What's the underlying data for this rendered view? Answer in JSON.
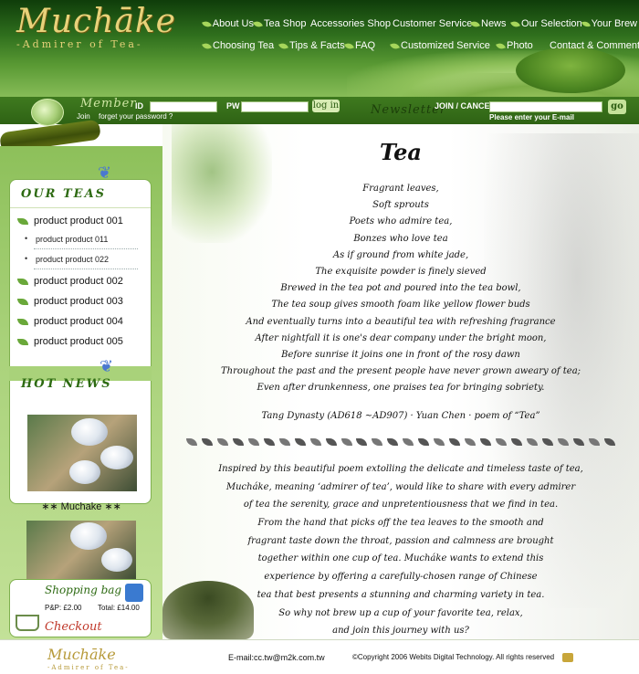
{
  "header": {
    "logo_text": "Muchāke",
    "logo_sub": "-Admirer of Tea-",
    "nav_row1": [
      "About Us",
      "Tea Shop",
      "Accessories Shop",
      "Customer Service",
      "News",
      "Our Selection",
      "Your Brew"
    ],
    "nav_row2": [
      "Choosing Tea",
      "Tips & Facts",
      "FAQ",
      "Customized Service",
      "Photo",
      "Contact & Comment"
    ]
  },
  "member": {
    "title": "Member",
    "id_label": "ID",
    "pw_label": "PW",
    "login_label": "log in",
    "join_label": "Join",
    "forgot_label": "forget your password ?",
    "newsletter_title": "Newsletter",
    "join_cancel_label": "JOIN / CANCEL",
    "email_prompt": "Please enter your E-mail",
    "go_label": "go"
  },
  "sidebar": {
    "our_teas_title": "OUR TEAS",
    "categories": [
      {
        "label": "product product  001"
      },
      {
        "label": "product product  002"
      },
      {
        "label": "product product  003"
      },
      {
        "label": "product product  004"
      },
      {
        "label": "product product  005"
      }
    ],
    "subcategories": [
      "product product  011",
      "product product  022"
    ],
    "hot_news_title": "HOT NEWS",
    "news_caption": "∗∗   Muchake   ∗∗",
    "shopping_bag_title": "Shopping bag",
    "pp_label": "P&P: £2.00",
    "total_label": "Total: £14.00",
    "checkout_label": "Checkout"
  },
  "main": {
    "title": "Tea",
    "poem": [
      "Fragrant leaves,",
      "Soft sprouts",
      "Poets who admire tea,",
      "Bonzes who love tea",
      "As if ground from white jade,",
      "The exquisite powder is finely sieved",
      "Brewed in the tea pot and poured into the tea bowl,",
      "The tea soup gives smooth foam like yellow flower buds",
      "And eventually turns into a beautiful tea with refreshing fragrance",
      "After nightfall it is one's dear company under the bright moon,",
      "Before sunrise it joins one in front of the rosy dawn",
      "Throughout the past and the present people have never grown aweary of tea;",
      "Even after drunkenness, one praises tea for bringing sobriety."
    ],
    "credit": "Tang Dynasty (AD618 ~AD907) · Yuan Chen · poem of “Tea”",
    "intro": [
      "Inspired by this beautiful poem extolling the delicate and timeless taste of tea,",
      "Mucháke, meaning ‘admirer of tea’, would like to share with every admirer",
      "of tea the serenity, grace and unpretentiousness that we find in tea.",
      "From the hand that picks off the tea leaves to the smooth and",
      "fragrant taste down the throat, passion and calmness are brought",
      "together within one cup of tea. Mucháke wants to extend this",
      "experience by offering a carefully-chosen range of Chinese",
      "tea that best presents a stunning and charming variety in tea.",
      "So why not brew up a cup of your favorite tea, relax,",
      "and join this journey with us?"
    ]
  },
  "footer": {
    "logo_text": "Muchāke",
    "logo_sub": "-Admirer of Tea-",
    "email": "E-mail:cc.tw@m2k.com.tw",
    "copyright": "©Copyright 2006 Webits Digital Technology. All rights reserved"
  }
}
